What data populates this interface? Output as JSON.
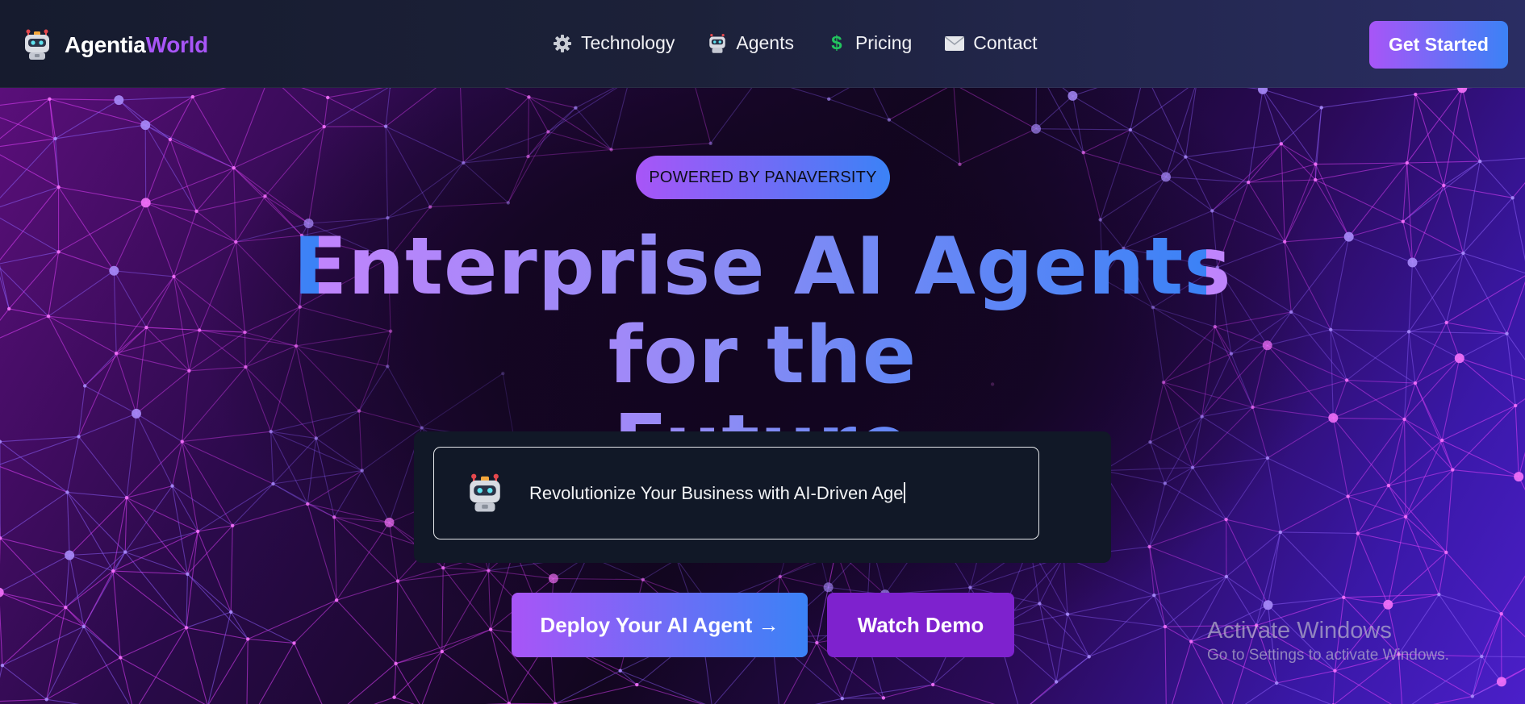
{
  "brand": {
    "logo_icon": "robot-icon",
    "name_part1": "Agentia",
    "name_part2": "World",
    "accent": "#a855f7"
  },
  "nav": {
    "items": [
      {
        "label": "Technology",
        "icon": "gear-icon"
      },
      {
        "label": "Agents",
        "icon": "robot-icon"
      },
      {
        "label": "Pricing",
        "icon": "dollar-icon"
      },
      {
        "label": "Contact",
        "icon": "envelope-icon"
      }
    ],
    "cta_label": "Get Started"
  },
  "hero": {
    "badge": "POWERED BY PANAVERSITY",
    "headline_line1": "Enterprise AI Agents",
    "headline_line2": "for the Future",
    "typing_text": "Revolutionize Your Business with AI-Driven Age",
    "primary_button": "Deploy Your AI Agent →",
    "secondary_button": "Watch Demo"
  },
  "watermark": {
    "title": "Activate Windows",
    "subtitle": "Go to Settings to activate Windows."
  },
  "colors": {
    "gradient_start": "#a855f7",
    "gradient_end": "#3b82f6",
    "secondary_button": "#7e22ce",
    "panel": "#111827"
  }
}
